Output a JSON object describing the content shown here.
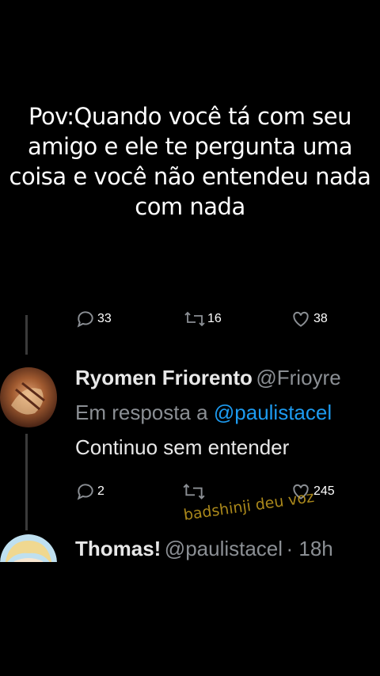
{
  "caption": "Pov:Quando você tá com seu amigo e ele te pergunta uma coisa e você não entendeu nada com nada",
  "prev_stats": {
    "replies": "33",
    "retweets": "16",
    "likes": "38"
  },
  "tweet1": {
    "display_name": "Ryomen Friorento",
    "handle": "@Frioyre",
    "reply_prefix": "Em resposta a",
    "reply_to": "@paulistacel",
    "text": "Continuo sem entender",
    "replies": "2",
    "likes": "245"
  },
  "tweet2": {
    "display_name": "Thomas!",
    "handle": "@paulistacel",
    "time": "· 18h"
  },
  "watermark": "badshinji deu voz",
  "colors": {
    "background": "#000000",
    "mention": "#1d9bf0",
    "muted": "#8b8f94",
    "watermark": "#c8a020"
  }
}
